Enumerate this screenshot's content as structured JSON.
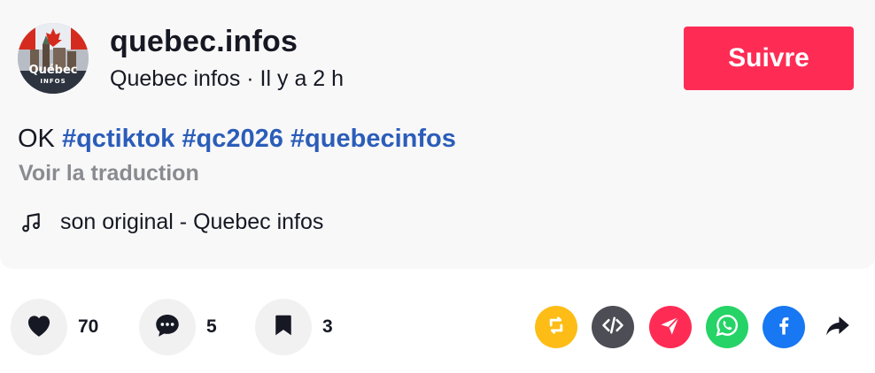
{
  "post": {
    "username": "quebec.infos",
    "display_name": "Quebec infos",
    "separator": " · ",
    "time_ago": "Il y a 2 h",
    "follow_label": "Suivre",
    "caption_text": "OK ",
    "hashtags": [
      "#qctiktok",
      "#qc2026",
      "#quebecinfos"
    ],
    "translate_label": "Voir la traduction",
    "sound": "son original - Quebec infos",
    "avatar_text": "Québec",
    "avatar_subtext": "INFOS"
  },
  "stats": {
    "likes": "70",
    "comments": "5",
    "saves": "3"
  },
  "share_icons": [
    "repost-icon",
    "embed-icon",
    "send-icon",
    "whatsapp-icon",
    "facebook-icon",
    "share-arrow-icon"
  ],
  "colors": {
    "follow": "#fe2c55",
    "hashtag": "#2b5db9",
    "repost": "#fdbd16",
    "embed": "#4c4d55",
    "send": "#fe2c55",
    "whatsapp": "#25d366",
    "facebook": "#1877f2"
  }
}
